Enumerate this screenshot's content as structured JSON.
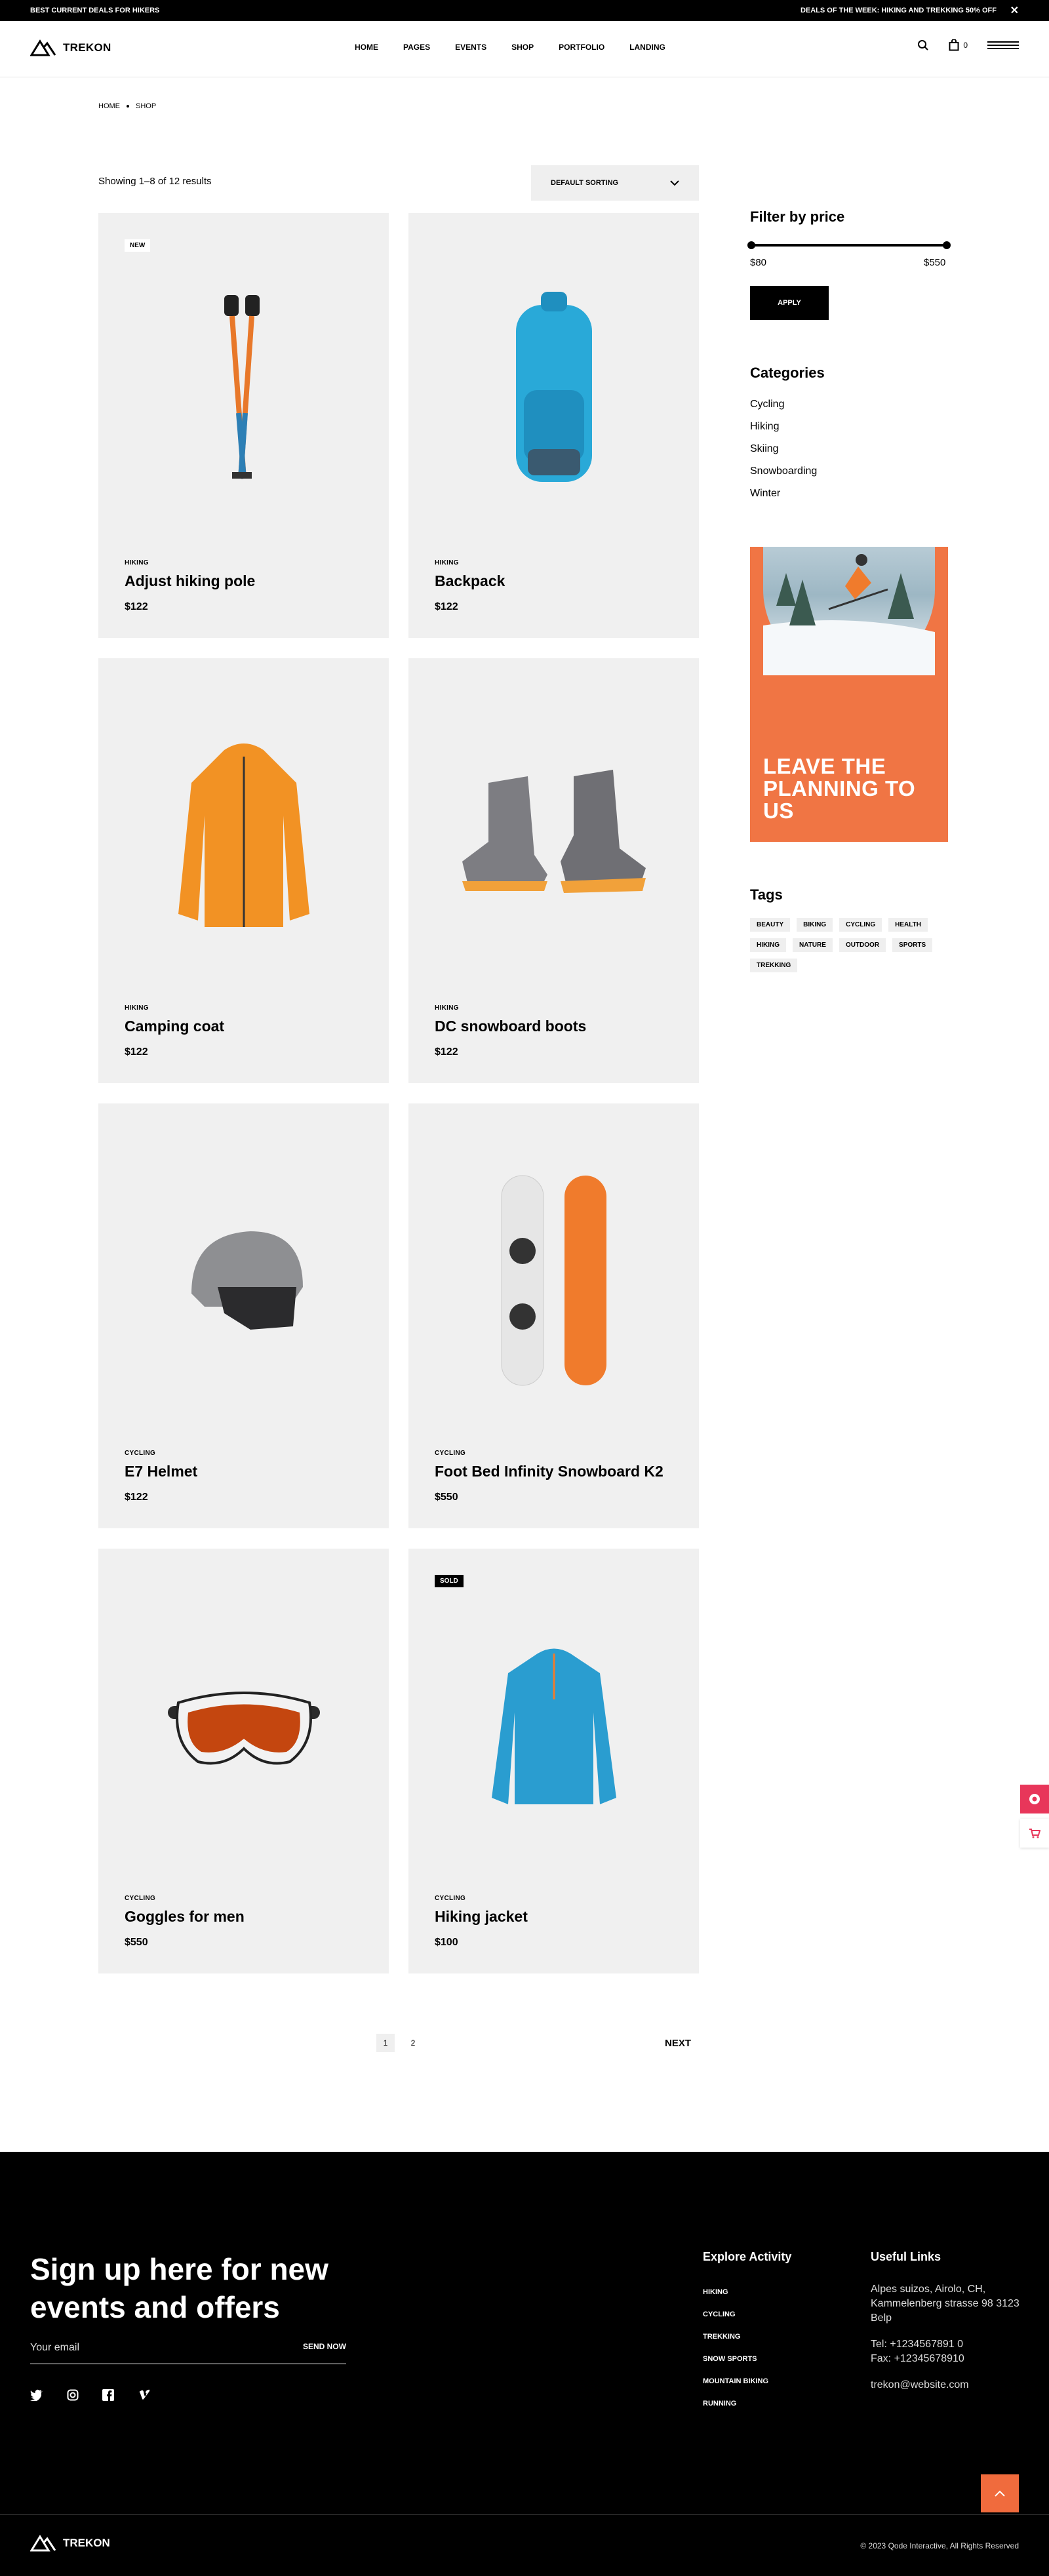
{
  "topbar": {
    "left": "BEST CURRENT DEALS FOR HIKERS",
    "right": "DEALS OF THE WEEK: HIKING AND TREKKING 50% OFF",
    "close": "✕"
  },
  "header": {
    "brand": "TREKON",
    "nav": [
      "HOME",
      "PAGES",
      "EVENTS",
      "SHOP",
      "PORTFOLIO",
      "LANDING"
    ],
    "cart_count": "0"
  },
  "breadcrumb": [
    "HOME",
    "SHOP"
  ],
  "shop": {
    "showing": "Showing 1–8 of 12 results",
    "sort": "DEFAULT SORTING"
  },
  "products": [
    {
      "cat": "HIKING",
      "name": "Adjust hiking pole",
      "price": "$122",
      "badge": "NEW",
      "icon": "hiking-pole-icon"
    },
    {
      "cat": "HIKING",
      "name": "Backpack",
      "price": "$122",
      "badge": "",
      "icon": "backpack-icon"
    },
    {
      "cat": "HIKING",
      "name": "Camping coat",
      "price": "$122",
      "badge": "",
      "icon": "coat-icon"
    },
    {
      "cat": "HIKING",
      "name": "DC snowboard boots",
      "price": "$122",
      "badge": "",
      "icon": "boots-icon"
    },
    {
      "cat": "CYCLING",
      "name": "E7 Helmet",
      "price": "$122",
      "badge": "",
      "icon": "helmet-icon"
    },
    {
      "cat": "CYCLING",
      "name": "Foot Bed Infinity Snowboard K2",
      "price": "$550",
      "badge": "",
      "icon": "snowboard-icon"
    },
    {
      "cat": "CYCLING",
      "name": "Goggles for men",
      "price": "$550",
      "badge": "",
      "icon": "goggles-icon"
    },
    {
      "cat": "CYCLING",
      "name": "Hiking jacket",
      "price": "$100",
      "badge": "SOLD",
      "icon": "jacket-icon"
    }
  ],
  "sidebar": {
    "price_title": "Filter by price",
    "price_min": "$80",
    "price_max": "$550",
    "apply": "APPLY",
    "cat_title": "Categories",
    "categories": [
      "Cycling",
      "Hiking",
      "Skiing",
      "Snowboarding",
      "Winter"
    ],
    "promo": "LEAVE THE PLANNING TO US",
    "tags_title": "Tags",
    "tags": [
      "BEAUTY",
      "BIKING",
      "CYCLING",
      "HEALTH",
      "HIKING",
      "NATURE",
      "OUTDOOR",
      "SPORTS",
      "TREKKING"
    ]
  },
  "pagination": {
    "p1": "1",
    "p2": "2",
    "next": "NEXT"
  },
  "footer": {
    "signup": "Sign up here for new events and offers",
    "email_placeholder": "Your email",
    "send": "SEND NOW",
    "explore_title": "Explore Activity",
    "explore": [
      "HIKING",
      "CYCLING",
      "TREKKING",
      "SNOW SPORTS",
      "MOUNTAIN BIKING",
      "RUNNING"
    ],
    "useful_title": "Useful Links",
    "address": "Alpes suizos, Airolo, CH, Kammelenberg strasse 98 3123 Belp",
    "tel": "Tel: +1234567891 0",
    "fax": "Fax: +12345678910",
    "email": "trekon@website.com",
    "brand": "TREKON",
    "copyright": "© 2023 Qode Interactive, All Rights Reserved"
  },
  "colors": {
    "accent": "#f06b3d",
    "card_bg": "#f0f0f0",
    "float_pink": "#e8365a"
  }
}
